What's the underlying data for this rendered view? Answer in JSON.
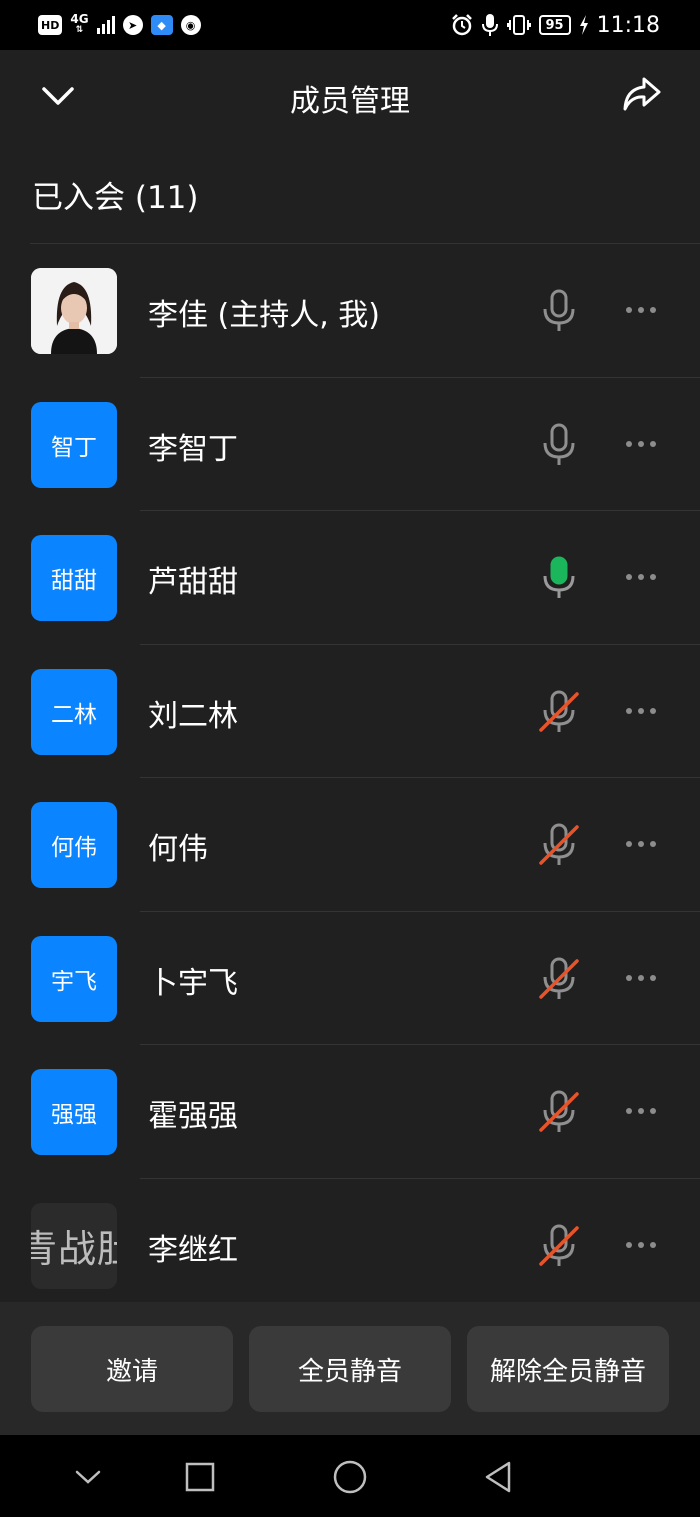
{
  "status_bar": {
    "hd_label": "HD",
    "network_top": "4G",
    "network_bottom": "⇅",
    "battery": "95",
    "time": "11:18"
  },
  "header": {
    "title": "成员管理"
  },
  "section": {
    "joined_label": "已入会 (11)"
  },
  "members": [
    {
      "avatar_text": "",
      "name": "李佳 (主持人, 我)",
      "mic": "on-gray"
    },
    {
      "avatar_text": "智丁",
      "name": "李智丁",
      "mic": "on-gray"
    },
    {
      "avatar_text": "甜甜",
      "name": "芦甜甜",
      "mic": "speaking"
    },
    {
      "avatar_text": "二林",
      "name": "刘二林",
      "mic": "muted"
    },
    {
      "avatar_text": "何伟",
      "name": "何伟",
      "mic": "muted"
    },
    {
      "avatar_text": "宇飞",
      "name": "卜宇飞",
      "mic": "muted"
    },
    {
      "avatar_text": "强强",
      "name": "霍强强",
      "mic": "muted"
    },
    {
      "avatar_text": "青战肚",
      "name": "李继红",
      "mic": "muted"
    }
  ],
  "actions": {
    "invite": "邀请",
    "mute_all": "全员静音",
    "unmute_all": "解除全员静音"
  },
  "colors": {
    "accent": "#0a84ff",
    "speaking": "#1bb55c",
    "muted_slash": "#e8542a",
    "background": "#202020"
  },
  "icons": {
    "back": "chevron-down-icon",
    "share": "share-icon",
    "mic": "microphone-icon",
    "more": "more-icon"
  }
}
